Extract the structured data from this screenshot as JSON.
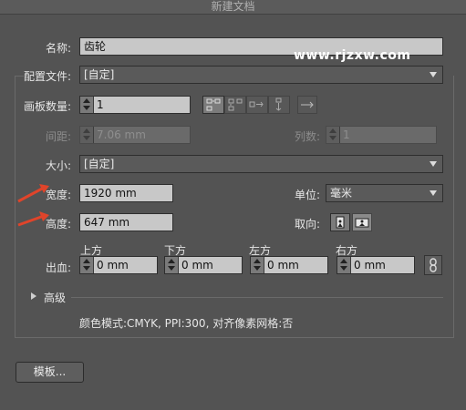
{
  "window": {
    "title": "新建文档"
  },
  "watermark": "www.rjzxw.com",
  "fields": {
    "name_label": "名称:",
    "name_value": "齿轮",
    "profile_label": "配置文件:",
    "profile_value": "[自定]",
    "artboards_label": "画板数量:",
    "artboards_value": "1",
    "spacing_label": "间距:",
    "spacing_value": "7.06 mm",
    "columns_label": "列数:",
    "columns_value": "1",
    "size_label": "大小:",
    "size_value": "[自定]",
    "width_label": "宽度:",
    "width_value": "1920 mm",
    "units_label": "单位:",
    "units_value": "毫米",
    "height_label": "高度:",
    "height_value": "647 mm",
    "orientation_label": "取向:"
  },
  "bleed": {
    "label": "出血:",
    "top_label": "上方",
    "top_value": "0 mm",
    "bottom_label": "下方",
    "bottom_value": "0 mm",
    "left_label": "左方",
    "left_value": "0 mm",
    "right_label": "右方",
    "right_value": "0 mm"
  },
  "advanced": {
    "label": "高级",
    "summary": "颜色模式:CMYK, PPI:300, 对齐像素网格:否"
  },
  "buttons": {
    "templates": "模板..."
  },
  "colors": {
    "background": "#535353",
    "field": "#c8c8c8",
    "annotation_arrow": "#e0442a",
    "watermark": "#ffffff"
  }
}
